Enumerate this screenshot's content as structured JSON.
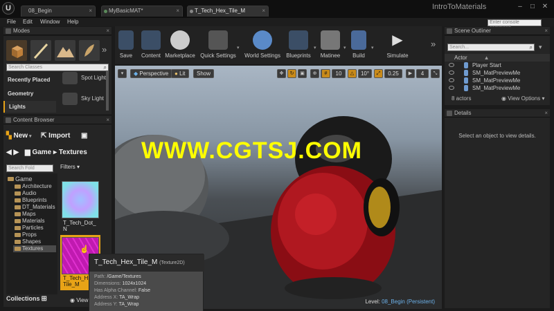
{
  "window": {
    "logo": "U",
    "tabs": [
      "08_Begin",
      "MyBasicMAT*",
      "T_Tech_Hex_Tile_M"
    ],
    "project": "IntroToMaterials",
    "controls": [
      "–",
      "□",
      "✕"
    ]
  },
  "menu": {
    "items": [
      "File",
      "Edit",
      "Window",
      "Help"
    ],
    "console_placeholder": "Enter console command"
  },
  "modes": {
    "title": "Modes",
    "search_placeholder": "Search Classes",
    "categories": [
      "Recently Placed",
      "Geometry",
      "Lights"
    ],
    "selected_category": "Lights",
    "items": [
      "Spot Light",
      "Sky Light"
    ]
  },
  "content_browser": {
    "title": "Content Browser",
    "new_label": "New",
    "import_label": "Import",
    "path": [
      "Game",
      "Textures"
    ],
    "folder_search_placeholder": "Search Fold",
    "filters_label": "Filters",
    "root": "Game",
    "folders": [
      "Architecture",
      "Audio",
      "Blueprints",
      "DT_Materials",
      "Maps",
      "Materials",
      "Particles",
      "Props",
      "Shapes",
      "Textures"
    ],
    "selected_folder": "Textures",
    "assets": [
      {
        "name1": "T_Tech_Dot_",
        "name2": "N"
      },
      {
        "name1": "T_Tech_H",
        "name2": "Tile_M"
      }
    ],
    "collections_label": "Collections",
    "view_label": "View"
  },
  "toolbar": {
    "buttons": [
      "Save",
      "Content",
      "Marketplace",
      "Quick Settings",
      "World Settings",
      "Blueprints",
      "Matinee",
      "Build",
      "Simulate"
    ]
  },
  "viewport": {
    "perspective_label": "Perspective",
    "lit_label": "Lit",
    "show_label": "Show",
    "grid_snap": "10",
    "rot_snap": "10°",
    "scale_snap": "0.25",
    "cam_speed": "4",
    "watermark": "WWW.CGTSJ.COM",
    "level_prefix": "Level:",
    "level_name": "08_Begin (Persistent)"
  },
  "scene_outliner": {
    "title": "Scene Outliner",
    "search_placeholder": "Search...",
    "column": "Actor",
    "rows": [
      "Player Start",
      "SM_MatPreviewMe",
      "SM_MatPreviewMe",
      "SM_MatPreviewMe"
    ],
    "count": "8 actors",
    "view_options": "View Options"
  },
  "details": {
    "title": "Details",
    "empty_message": "Select an object to view details."
  },
  "tooltip": {
    "name": "T_Tech_Hex_Tile_M",
    "type": "(Texture2D)",
    "lines": [
      {
        "k": "Path:",
        "v": "/Game/Textures"
      },
      {
        "k": "Dimensions:",
        "v": "1024x1024"
      },
      {
        "k": "Has Alpha Channel:",
        "v": "False"
      },
      {
        "k": "Address X:",
        "v": "TA_Wrap"
      },
      {
        "k": "Address Y:",
        "v": "TA_Wrap"
      }
    ]
  },
  "colors": {
    "accent": "#e8a317",
    "selection": "#4a4a4a",
    "level_link": "#6cb0e8"
  }
}
